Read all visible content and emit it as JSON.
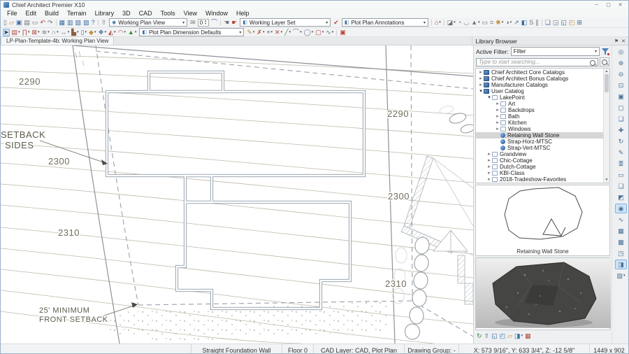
{
  "window": {
    "title": "Chief Architect Premier X10",
    "controls": {
      "minimize": "─",
      "maximize": "▢",
      "close": "✕"
    }
  },
  "menu": {
    "items": [
      {
        "label": "File"
      },
      {
        "label": "Edit"
      },
      {
        "label": "Build"
      },
      {
        "label": "Terrain"
      },
      {
        "label": "Library"
      },
      {
        "label": "3D"
      },
      {
        "label": "CAD"
      },
      {
        "label": "Tools"
      },
      {
        "label": "View"
      },
      {
        "label": "Window"
      },
      {
        "label": "Help"
      }
    ]
  },
  "toolbar1": {
    "file_icons": [
      {
        "n": "new-plan",
        "g": "▯",
        "c": "g"
      },
      {
        "n": "open-plan",
        "g": "▱",
        "c": "y"
      },
      {
        "n": "save-plan",
        "g": "▣",
        "c": "b"
      },
      {
        "n": "print",
        "g": "▤",
        "c": "g"
      },
      {
        "n": "close-view",
        "g": "▭",
        "c": "g"
      },
      {
        "n": "undo",
        "g": "↶",
        "c": "r"
      },
      {
        "n": "redo",
        "g": "↷",
        "c": "g"
      }
    ],
    "view_icons": [
      {
        "n": "plan-view",
        "g": "▦",
        "c": "b"
      },
      {
        "n": "elevation-view",
        "g": "▥",
        "c": "b"
      },
      {
        "n": "materials-list",
        "g": "▧",
        "c": "b"
      },
      {
        "n": "schedule-view",
        "g": "▨",
        "c": "b"
      },
      {
        "n": "help",
        "g": "?",
        "c": "b"
      }
    ],
    "export_icons": [
      {
        "n": "export-picture",
        "g": "⇧",
        "c": "g"
      }
    ],
    "view_combo": {
      "value": "Working Plan View"
    },
    "spin_value": "0",
    "arc_icons": [
      {
        "n": "send-mail",
        "g": "✉",
        "c": "g"
      }
    ],
    "arc2_icons": [
      {
        "n": "arc-creation-mode",
        "g": "⌒",
        "c": "b"
      }
    ],
    "glove_icons": [
      {
        "n": "match-properties",
        "g": "☚",
        "c": "g"
      },
      {
        "n": "apply-properties",
        "g": "☛",
        "c": "r"
      }
    ],
    "layer_combo": {
      "value": "Working Layer Set"
    },
    "layer_check_icons": [
      {
        "n": "layer-display-options",
        "g": "✔",
        "c": "r"
      }
    ],
    "anno_combo": {
      "value": "Plot Plan Annotations"
    },
    "default_icons": [
      {
        "n": "default-settings-home",
        "g": "⌂",
        "c": "r",
        "caret": 1
      }
    ],
    "render_icons": [
      {
        "n": "picture-tools",
        "g": "◪",
        "c": "g",
        "caret": 1
      },
      {
        "n": "cross-section",
        "g": "◔",
        "c": "g"
      },
      {
        "n": "backclip-section",
        "g": "◡",
        "c": "g"
      },
      {
        "n": "perspective-view",
        "g": "▲",
        "c": "g",
        "caret": 1
      },
      {
        "n": "frame-view",
        "g": "▭",
        "c": "g"
      },
      {
        "n": "ruler-grid",
        "g": "⌗",
        "c": "g"
      },
      {
        "n": "lighting",
        "g": "✺",
        "c": "y",
        "caret": 1
      },
      {
        "n": "shadows",
        "g": "◑",
        "c": "g",
        "caret": 1
      },
      {
        "n": "north-pointer",
        "g": "↗",
        "c": "b"
      },
      {
        "n": "color-toggle",
        "g": "◧",
        "c": "b"
      },
      {
        "n": "spin-model",
        "g": "S",
        "c": "g"
      },
      {
        "n": "parallel-lines",
        "g": "∥",
        "c": "g"
      }
    ],
    "window_icons": [
      {
        "n": "tile-windows",
        "g": "❏",
        "c": "b"
      },
      {
        "n": "window-previous",
        "g": "◲",
        "c": "g"
      },
      {
        "n": "window-picture",
        "g": "◱",
        "c": "b"
      },
      {
        "n": "window-swap",
        "g": "◰",
        "c": "y"
      },
      {
        "n": "window-grid",
        "g": "⊞",
        "c": "b"
      }
    ]
  },
  "toolbar2": {
    "select_icons": [
      {
        "n": "select-objects-arrow",
        "g": "➤",
        "c": "d",
        "sel": 1
      }
    ],
    "build_icons": [
      {
        "n": "wall-tools",
        "g": "▤",
        "c": "r",
        "caret": 1
      },
      {
        "n": "door-tools",
        "g": "∏",
        "c": "r",
        "caret": 1
      },
      {
        "n": "window-tools",
        "g": "⊠",
        "c": "r",
        "caret": 1
      },
      {
        "n": "railing-tools",
        "g": "≋",
        "c": "g",
        "caret": 1
      },
      {
        "n": "curved-wall-tools",
        "g": "∩",
        "c": "g",
        "caret": 1
      },
      {
        "n": "dimension-tools",
        "g": "↔",
        "c": "g",
        "caret": 1
      },
      {
        "n": "cabinet-tools",
        "g": "▙",
        "c": "n",
        "caret": 1
      },
      {
        "n": "fixture-tools",
        "g": "▯",
        "c": "b",
        "caret": 1
      },
      {
        "n": "material-painter",
        "g": "◆",
        "c": "y",
        "caret": 1
      },
      {
        "n": "library-object",
        "g": "❖",
        "c": "b",
        "caret": 1
      },
      {
        "n": "roof-tools",
        "g": "◭",
        "c": "r",
        "caret": 1
      },
      {
        "n": "ceiling-tools",
        "g": "◠",
        "c": "r",
        "caret": 1
      },
      {
        "n": "terrain-tools",
        "g": "▲",
        "c": "G",
        "caret": 1
      }
    ],
    "dim_combo": {
      "value": "Plot Plan Dimension Defaults"
    },
    "cad_icons": [
      {
        "n": "text-tools",
        "g": "✎",
        "c": "y",
        "caret": 1
      },
      {
        "n": "node-edit",
        "g": "✗",
        "c": "r",
        "caret": 1
      },
      {
        "n": "point-tools",
        "g": "⌖",
        "c": "g",
        "caret": 1
      },
      {
        "n": "marker-tools",
        "g": "✕",
        "c": "r",
        "caret": 1
      },
      {
        "n": "line-tools",
        "g": "╱",
        "c": "g",
        "caret": 1
      },
      {
        "n": "arc-tools",
        "g": "⌒",
        "c": "g",
        "caret": 1
      },
      {
        "n": "circle-tools",
        "g": "◯",
        "c": "g",
        "caret": 1
      },
      {
        "n": "box-tools",
        "g": "▢",
        "c": "r",
        "caret": 1
      },
      {
        "n": "spline-tools",
        "g": "∿",
        "c": "g",
        "caret": 1
      }
    ],
    "detail_icons": [
      {
        "n": "cad-detail",
        "g": "▣",
        "c": "r"
      }
    ]
  },
  "tabbar": {
    "active_tab": "LP-Plan-Template-4b: Working Plan View"
  },
  "canvas": {
    "contour_labels": {
      "left_2290": "2290",
      "right_2290": "2290",
      "left_2300": "2300",
      "right_2300": "2300",
      "left_2310": "2310",
      "right_2310": "2310"
    },
    "annotations": {
      "setback_sides_line1": "SETBACK",
      "setback_sides_line2": "SIDES",
      "front_setback_line1": "25' MINIMUM",
      "front_setback_line2": "FRONT SETBACK"
    }
  },
  "library": {
    "title": "Library Browser",
    "active_filter_label": "Active Filter:",
    "filter_value": "Filter",
    "search_placeholder": "Type to start searching...",
    "tree": [
      {
        "label": "Chief Architect Core Catalogs",
        "level": 0,
        "icon": "cat",
        "chev": "r"
      },
      {
        "label": "Chief Architect Bonus Catalogs",
        "level": 0,
        "icon": "cat",
        "chev": "r"
      },
      {
        "label": "Manufacturer Catalogs",
        "level": 0,
        "icon": "cat",
        "chev": "r"
      },
      {
        "label": "User Catalog",
        "level": 0,
        "icon": "cat",
        "chev": "d"
      },
      {
        "label": "LakePoint",
        "level": 1,
        "icon": "folder",
        "chev": "d"
      },
      {
        "label": "Art",
        "level": 2,
        "icon": "folder",
        "chev": "r"
      },
      {
        "label": "Backdrops",
        "level": 2,
        "icon": "folder",
        "chev": "r"
      },
      {
        "label": "Bath",
        "level": 2,
        "icon": "folder",
        "chev": "r"
      },
      {
        "label": "Kitchen",
        "level": 2,
        "icon": "folder",
        "chev": "r"
      },
      {
        "label": "Windows",
        "level": 2,
        "icon": "folder",
        "chev": "r"
      },
      {
        "label": "Retaining Wall Stone",
        "level": 2,
        "icon": "sphere",
        "chev": "n",
        "sel": 1
      },
      {
        "label": "Strap-Horz-MTSC",
        "level": 2,
        "icon": "sphere",
        "chev": "n"
      },
      {
        "label": "Strap-Vert-MTSC",
        "level": 2,
        "icon": "sphere",
        "chev": "n"
      },
      {
        "label": "Grandview",
        "level": 1,
        "icon": "folder",
        "chev": "r"
      },
      {
        "label": "Chic-Cottage",
        "level": 1,
        "icon": "folder",
        "chev": "r"
      },
      {
        "label": "Dutch-Cottage",
        "level": 1,
        "icon": "folder",
        "chev": "r"
      },
      {
        "label": "KBI-Class",
        "level": 1,
        "icon": "folder",
        "chev": "r"
      },
      {
        "label": "2018-Tradeshow-Favorites",
        "level": 1,
        "icon": "folder",
        "chev": "r"
      }
    ],
    "preview_caption": "Retaining Wall Stone",
    "bottom_icons": [
      {
        "n": "refresh-library",
        "g": "↻",
        "c": "G"
      },
      {
        "n": "import-library",
        "g": "⇧",
        "c": "b"
      },
      {
        "n": "export-library",
        "g": "◱",
        "c": "b"
      },
      {
        "n": "catalog-browse",
        "g": "◰",
        "c": "b"
      },
      {
        "n": "open-library-folder",
        "g": "▱",
        "c": "y"
      },
      {
        "n": "preview-pane-toggle",
        "g": "◨",
        "c": "b",
        "caret": 1
      },
      {
        "n": "details-pane-toggle",
        "g": "▦",
        "c": "r"
      }
    ]
  },
  "right_toolbar": {
    "items": [
      {
        "n": "zoom",
        "g": "◎"
      },
      {
        "n": "zoom-in",
        "g": "⊕"
      },
      {
        "n": "zoom-out",
        "g": "⊖"
      },
      {
        "n": "zoom-selected",
        "g": "⊡"
      },
      {
        "n": "fill-window",
        "g": "▣"
      },
      {
        "n": "fill-window-lot",
        "g": "▢"
      },
      {
        "n": "undo-zoom",
        "g": "❏"
      },
      {
        "n": "pan-window",
        "g": "✚"
      },
      {
        "n": "refresh-display",
        "g": "↻"
      },
      {
        "n": "edit-object",
        "g": "✎"
      },
      {
        "n": "components",
        "g": "≣"
      },
      {
        "n": "open-object",
        "g": "▭"
      },
      {
        "n": "copy-paste",
        "g": "❑"
      },
      {
        "n": "select-similar",
        "g": "◩"
      },
      {
        "n": "render-preview",
        "g": "◉",
        "sel": 1
      },
      {
        "n": "spline-edit",
        "g": "∿"
      },
      {
        "n": "grid-snaps",
        "g": "▦"
      },
      {
        "n": "angle-snaps",
        "g": "▩"
      },
      {
        "n": "object-snaps",
        "g": "◳"
      },
      {
        "n": "image-preview",
        "g": "◨",
        "sel": 1
      },
      {
        "n": "pattern-options",
        "g": "▧",
        "caret": 1
      }
    ]
  },
  "statusbar": {
    "tool": "Straight Foundation Wall",
    "floor": "Floor 0",
    "cad_layer": "CAD Layer: CAD, Plot Plan",
    "drawing_group": "Drawing Group: -",
    "coords": "X: 573 9/16\", Y: 633 3/4\", Z: -12 5/8\"",
    "resolution": "1449 x 902"
  }
}
